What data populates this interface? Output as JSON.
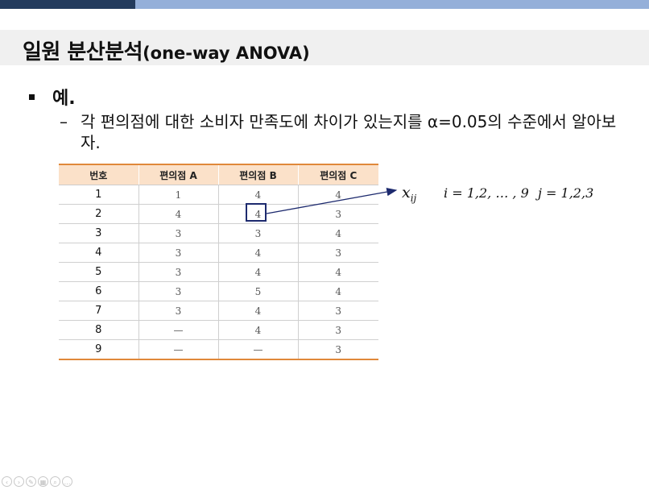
{
  "slide": {
    "title_main": "일원 분산분석",
    "title_sub": "(one-way ANOVA)",
    "bullet1": "예.",
    "bullet2_dash": "–",
    "bullet2_text": "각 편의점에 대한 소비자 만족도에 차이가 있는지를 α=0.05의 수준에서 알아보자."
  },
  "table": {
    "headers": [
      "번호",
      "편의점 A",
      "편의점 B",
      "편의점 C"
    ],
    "rows": [
      [
        "1",
        "1",
        "4",
        "4"
      ],
      [
        "2",
        "4",
        "4",
        "3"
      ],
      [
        "3",
        "3",
        "3",
        "4"
      ],
      [
        "4",
        "3",
        "4",
        "3"
      ],
      [
        "5",
        "3",
        "4",
        "4"
      ],
      [
        "6",
        "3",
        "5",
        "4"
      ],
      [
        "7",
        "3",
        "4",
        "3"
      ],
      [
        "8",
        "—",
        "4",
        "3"
      ],
      [
        "9",
        "—",
        "—",
        "3"
      ]
    ]
  },
  "annotation": {
    "symbol": "x",
    "subscript": "ij",
    "i_range": "i = 1,2, … , 9",
    "j_range": "j = 1,2,3"
  },
  "colors": {
    "topbar_dark": "#233b5d",
    "topbar_light": "#94afd9",
    "header_fill": "#fbe1c9",
    "table_rule": "#e0883a",
    "highlight_box": "#1d2a6e"
  },
  "nav_icons": [
    "prev-icon",
    "next-icon",
    "pen-icon",
    "slides-icon",
    "zoom-icon",
    "more-icon"
  ]
}
